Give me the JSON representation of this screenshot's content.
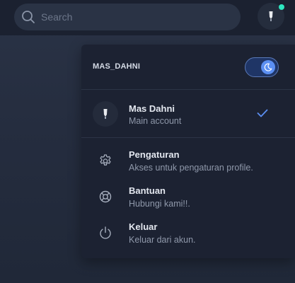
{
  "search": {
    "placeholder": "Search",
    "icon": "search-icon"
  },
  "topbar": {
    "avatar_icon": "user-avatar-icon",
    "status_color": "#2ee6c0"
  },
  "menu": {
    "username": "MAS_DAHNI",
    "dark_mode_toggle": {
      "on": true,
      "icon": "moon-icon",
      "accent": "#5b8ff2"
    },
    "account": {
      "name": "Mas Dahni",
      "subtitle": "Main account",
      "selected": true
    },
    "items": [
      {
        "title": "Pengaturan",
        "subtitle": "Akses untuk pengaturan profile.",
        "icon": "gear-icon"
      },
      {
        "title": "Bantuan",
        "subtitle": "Hubungi kami!!.",
        "icon": "lifebuoy-icon"
      },
      {
        "title": "Keluar",
        "subtitle": "Keluar dari akun.",
        "icon": "power-icon"
      }
    ]
  }
}
